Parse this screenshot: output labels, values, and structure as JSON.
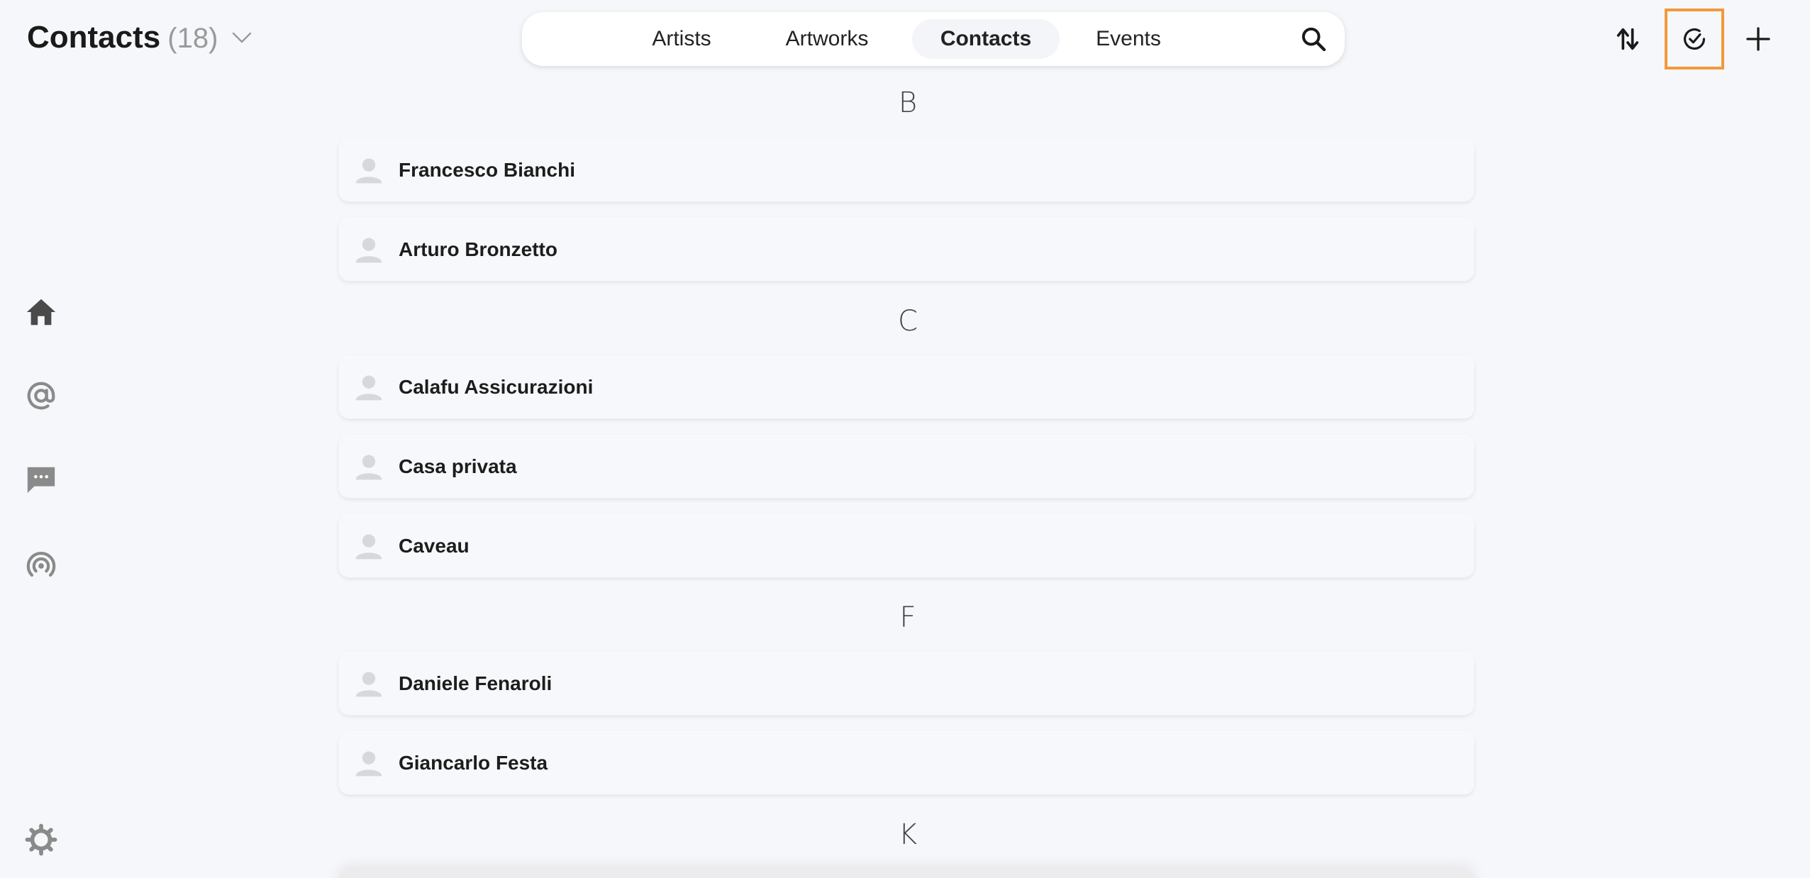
{
  "header": {
    "title": "Contacts",
    "count": "(18)",
    "icons": {
      "dropdown": "chevron-down-icon",
      "sort": "sort-icon",
      "select": "check-circle-icon",
      "add": "plus-icon"
    }
  },
  "tabs": [
    {
      "label": "Artists",
      "active": false
    },
    {
      "label": "Artworks",
      "active": false
    },
    {
      "label": "Contacts",
      "active": true
    },
    {
      "label": "Events",
      "active": false
    }
  ],
  "sidebar": {
    "items": [
      "home-icon",
      "at-sign-icon",
      "chat-icon",
      "broadcast-icon"
    ],
    "settings": "gear-icon"
  },
  "sections": [
    {
      "letter": "B",
      "contacts": [
        "Francesco Bianchi",
        "Arturo Bronzetto"
      ]
    },
    {
      "letter": "C",
      "contacts": [
        "Calafu Assicurazioni",
        "Casa privata",
        "Caveau"
      ]
    },
    {
      "letter": "F",
      "contacts": [
        "Daniele Fenaroli",
        "Giancarlo Festa"
      ]
    },
    {
      "letter": "K",
      "contacts": []
    }
  ],
  "colors": {
    "accent": "#f2993a",
    "background": "#f6f7fa",
    "icon": "#555555"
  }
}
